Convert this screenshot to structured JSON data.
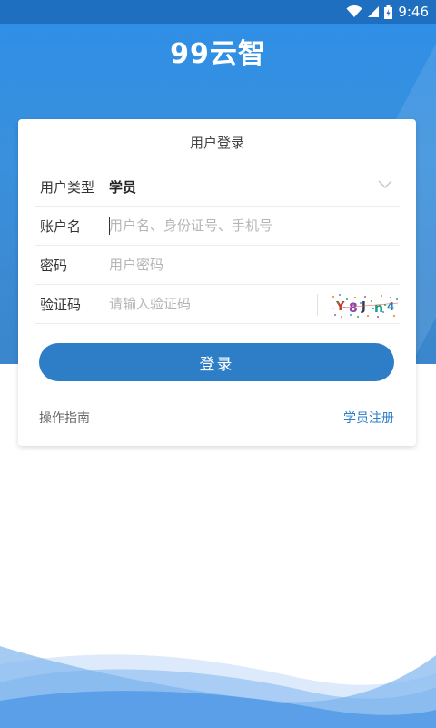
{
  "status_bar": {
    "time": "9:46"
  },
  "app": {
    "logo_text": "99云智"
  },
  "login_card": {
    "title": "用户登录",
    "user_type": {
      "label": "用户类型",
      "value": "学员"
    },
    "account": {
      "label": "账户名",
      "placeholder": "用户名、身份证号、手机号"
    },
    "password": {
      "label": "密码",
      "placeholder": "用户密码"
    },
    "captcha": {
      "label": "验证码",
      "placeholder": "请输入验证码"
    },
    "login_button": "登录",
    "guide_link": "操作指南",
    "register_link": "学员注册"
  },
  "colors": {
    "primary": "#2e7dc7",
    "header": "#3a90dc"
  }
}
